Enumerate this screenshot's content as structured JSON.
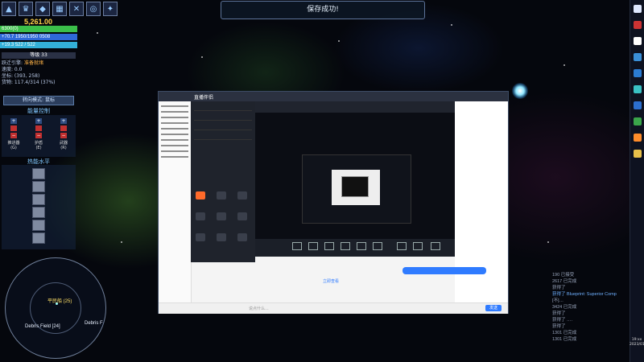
{
  "game": {
    "credits": "5,261.00",
    "toolbar_icons": [
      "ship-icon",
      "trophy-icon",
      "shield-badge-icon",
      "grid-icon",
      "wing-icon",
      "orbit-icon",
      "star-icon"
    ],
    "stats": {
      "hp_line": "6300(0)",
      "shield_line": "+70.7 1950/1950 0508",
      "energy_line": "+19.3   522 / 522",
      "level_label": "等级 33"
    },
    "info": {
      "engine_label": "跃迁引擎:",
      "engine_value": "准备就绪",
      "speed": "速度: 0.0",
      "coords": "坐标: (393, 258)",
      "cargo": "货物: 117.4/314 (37%)"
    },
    "mode_button": "转向模式: 鼠标",
    "power_title": "能量控制",
    "power_columns": [
      {
        "label": "推进器",
        "key": "(G)"
      },
      {
        "label": "护盾",
        "key": "(E)"
      },
      {
        "label": "武器",
        "key": "(R)"
      }
    ],
    "heat_title": "热能水平",
    "minimap": {
      "label_center": "平民船 (25)",
      "label_left": "Debris Field [24]",
      "label_right": "Debris F"
    },
    "toast": "保存成功!"
  },
  "embedded_window": {
    "app_name": "直播伴侣",
    "input_placeholder": "说点什么...",
    "send_label": "发送",
    "link_text": "立即查看"
  },
  "chatlog": {
    "lines": [
      "190 已接受",
      "2617 已完成",
      "获得了",
      "获得了 Blueprint: Superior Comp",
      "[不]…",
      "3424 已完成",
      "获得了",
      "获得了 ….",
      "获得了",
      "1301 已完成",
      "1301 已完成"
    ],
    "highlight": "Blueprint: Superior Comp"
  },
  "taskbar": {
    "time": "19:xx",
    "date": "2023/01"
  },
  "colors": {
    "credits": "#ffd24a",
    "health_bar": "#3bbf4a",
    "shield_bar": "#2f69d8",
    "energy_bar": "#33b0d8",
    "accent_orange": "#ff6a2a"
  }
}
